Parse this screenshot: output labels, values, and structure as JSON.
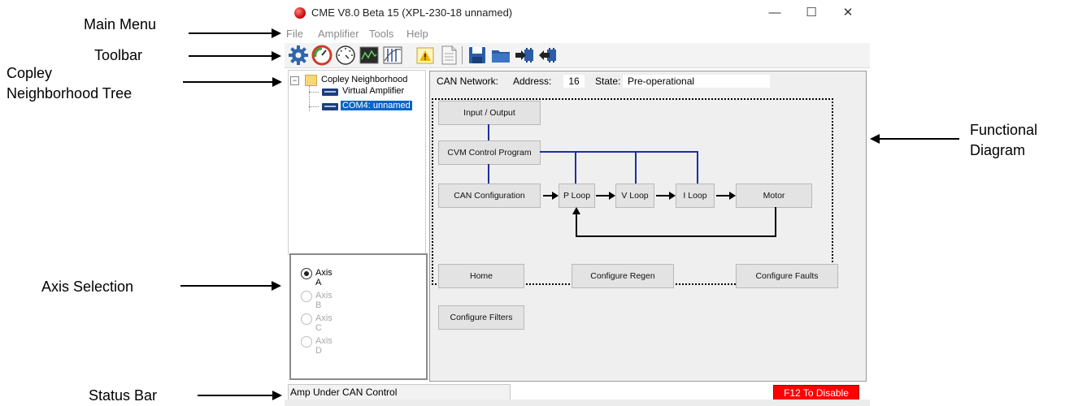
{
  "window": {
    "title": "CME V8.0 Beta 15 (XPL-230-18 unnamed)",
    "controls": {
      "minimize": "—",
      "maximize": "☐",
      "close": "✕"
    }
  },
  "menu": [
    "File",
    "Amplifier",
    "Tools",
    "Help"
  ],
  "toolbar": {
    "icons": [
      "gear-icon",
      "gauge-icon",
      "dial-icon",
      "scope-icon",
      "chart-icon",
      "warning-icon",
      "document-icon",
      "save-icon",
      "folder-icon",
      "download-icon",
      "upload-icon"
    ]
  },
  "tree": {
    "root": "Copley Neighborhood",
    "items": [
      {
        "label": "Virtual Amplifier",
        "selected": false
      },
      {
        "label": "COM4: unnamed",
        "selected": true
      }
    ]
  },
  "can_network": {
    "label": "CAN Network:",
    "address_label": "Address:",
    "address_value": "16",
    "state_label": "State:",
    "state_value": "Pre-operational"
  },
  "diagram": {
    "input_output": "Input / Output",
    "cvm_control_program": "CVM Control Program",
    "can_configuration": "CAN Configuration",
    "p_loop": "P Loop",
    "v_loop": "V Loop",
    "i_loop": "I Loop",
    "motor": "Motor"
  },
  "buttons": {
    "home": "Home",
    "configure_regen": "Configure Regen",
    "configure_faults": "Configure Faults",
    "configure_filters": "Configure Filters"
  },
  "axis_selection": {
    "options": [
      {
        "label": "Axis A",
        "checked": true,
        "enabled": true
      },
      {
        "label": "Axis B",
        "checked": false,
        "enabled": false
      },
      {
        "label": "Axis C",
        "checked": false,
        "enabled": false
      },
      {
        "label": "Axis D",
        "checked": false,
        "enabled": false
      }
    ]
  },
  "status": {
    "left": "Amp Under CAN Control",
    "right": "F12 To Disable"
  },
  "annotations": {
    "main_menu": "Main Menu",
    "toolbar": "Toolbar",
    "tree_line1": "Copley",
    "tree_line2": "Neighborhood Tree",
    "axis_selection": "Axis Selection",
    "status_bar": "Status Bar",
    "functional_line1": "Functional",
    "functional_line2": "Diagram"
  },
  "colors": {
    "selection": "#0a64c8",
    "connector_blue": "#1c2fa6",
    "disable_red": "#ff0000"
  }
}
